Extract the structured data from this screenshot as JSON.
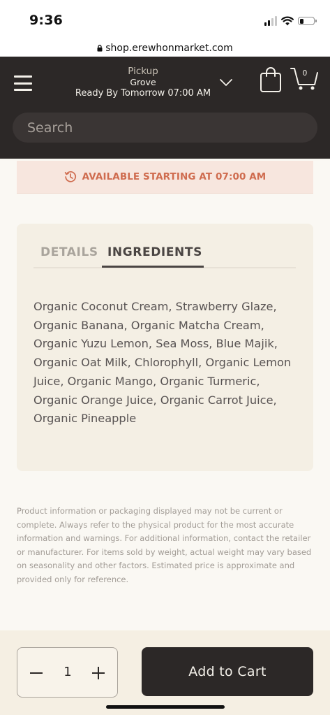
{
  "status_bar": {
    "time": "9:36"
  },
  "browser": {
    "url": "shop.erewhonmarket.com"
  },
  "header": {
    "pickup_label": "Pickup",
    "store": "Grove",
    "ready_text": "Ready By Tomorrow 07:00 AM",
    "cart_count": "0",
    "icons": [
      "menu-icon",
      "chevron-down-icon",
      "shopping-bag-icon",
      "cart-icon"
    ]
  },
  "search": {
    "placeholder": "Search"
  },
  "availability": {
    "text": "AVAILABLE STARTING AT 07:00 AM",
    "icon": "clock-icon",
    "color": "#cf6c4f"
  },
  "product": {
    "tabs": [
      {
        "label": "DETAILS",
        "active": false
      },
      {
        "label": "INGREDIENTS",
        "active": true
      }
    ],
    "ingredients": "Organic Coconut Cream, Strawberry Glaze, Organic Banana, Organic Matcha Cream, Organic Yuzu Lemon, Sea Moss, Blue Majik, Organic Oat Milk, Chlorophyll, Organic Lemon Juice, Organic Mango, Organic Turmeric, Organic Orange Juice, Organic Carrot Juice, Organic Pineapple"
  },
  "disclaimer": "Product information or packaging displayed may not be current or complete. Always refer to the physical product for the most accurate information and warnings. For additional information, contact the retailer or manufacturer. For items sold by weight, actual weight may vary based on seasonality and other factors. Estimated price is approximate and provided only for reference.",
  "purchase": {
    "quantity": "1",
    "add_to_cart_label": "Add to Cart"
  },
  "colors": {
    "header_bg": "#2c2827",
    "page_bg": "#faf8f3",
    "card_bg": "#f4efe4",
    "accent": "#cf6c4f"
  }
}
